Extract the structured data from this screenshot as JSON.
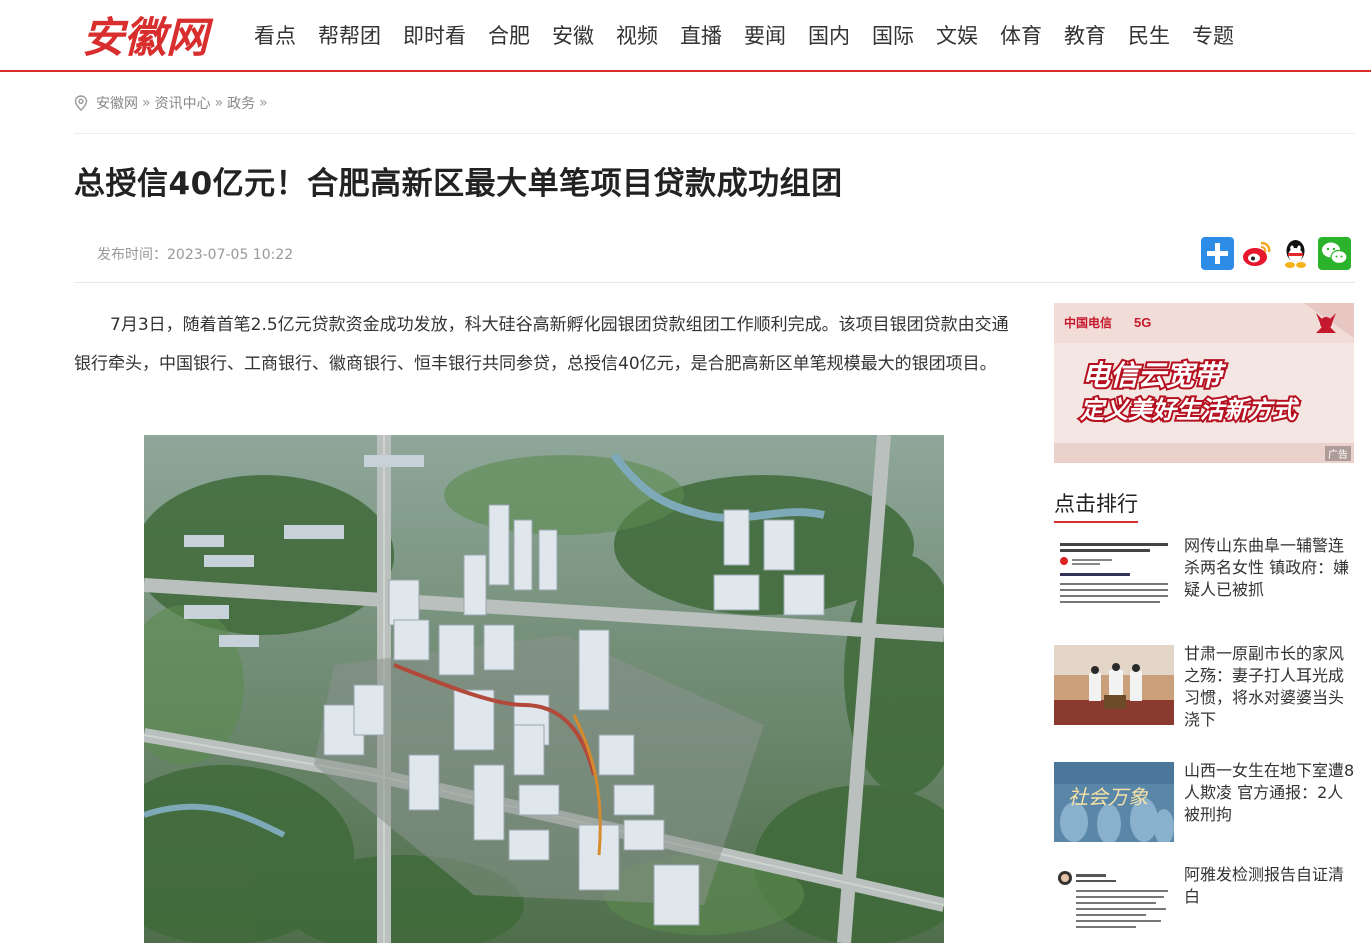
{
  "header": {
    "logo_text": "安徽网",
    "nav": [
      "看点",
      "帮帮团",
      "即时看",
      "合肥",
      "安徽",
      "视频",
      "直播",
      "要闻",
      "国内",
      "国际",
      "文娱",
      "体育",
      "教育",
      "民生",
      "专题"
    ]
  },
  "breadcrumb": {
    "items": [
      "安徽网",
      "资讯中心",
      "政务"
    ],
    "separator": "»"
  },
  "article": {
    "title": "总授信40亿元！合肥高新区最大单笔项目贷款成功组团",
    "publish_time": "发布时间：2023-07-05 10:22",
    "paragraph": "7月3日，随着首笔2.5亿元贷款资金成功发放，科大硅谷高新孵化园银团贷款组团工作顺利完成。该项目银团贷款由交通银行牵头，中国银行、工商银行、徽商银行、恒丰银行共同参贷，总授信40亿元，是合肥高新区单笔规模最大的银团项目。"
  },
  "share": {
    "icons": [
      "plus-share-icon",
      "weibo-icon",
      "qq-icon",
      "wechat-icon"
    ]
  },
  "ad": {
    "brand": "中国电信",
    "badge": "5G",
    "line1": "电信云宽带",
    "line2": "定义美好生活新方式",
    "tag": "广告"
  },
  "ranking": {
    "heading": "点击排行",
    "items": [
      {
        "title": "网传山东曲阜一辅警连杀两名女性 镇政府：嫌疑人已被抓"
      },
      {
        "title": "甘肃一原副市长的家风之殇：妻子打人耳光成习惯，将水对婆婆当头浇下"
      },
      {
        "title": "山西一女生在地下室遭8人欺凌 官方通报：2人被刑拘",
        "thumb_text": "社会万象"
      },
      {
        "title": "阿雅发检测报告自证清白"
      }
    ]
  },
  "colors": {
    "brand_red": "#d92e2e",
    "title": "#222222",
    "muted": "#999999"
  }
}
